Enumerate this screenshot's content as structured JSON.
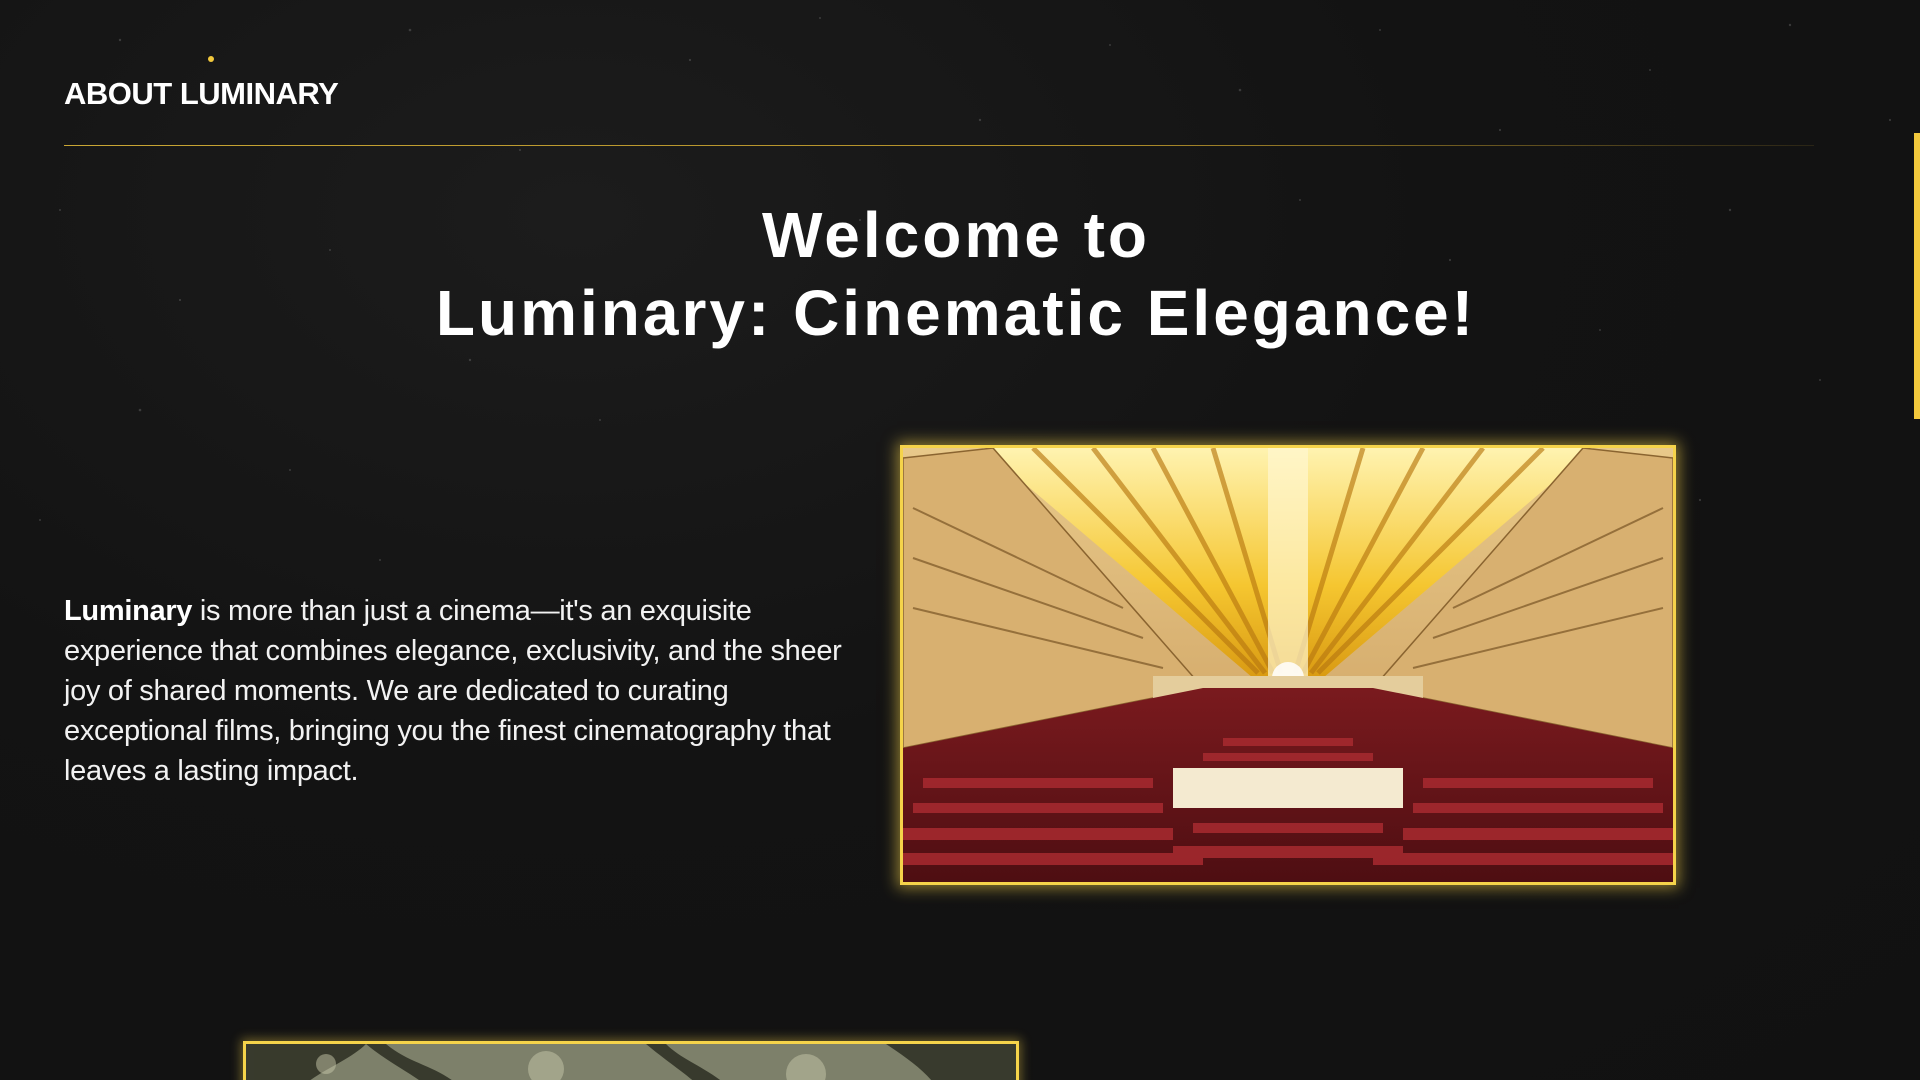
{
  "section": {
    "title": "ABOUT LUMINARY"
  },
  "headline": {
    "line1": "Welcome to",
    "line2": "Luminary: Cinematic Elegance!"
  },
  "intro": {
    "brand": "Luminary",
    "text": " is more than just a cinema—it's an exquisite experience that combines elegance, exclusivity, and the sheer joy of shared moments. We are dedicated to curating exceptional films, bringing you the finest cinematography that leaves a lasting impact."
  },
  "images": {
    "auditorium": "auditorium-photo",
    "second": "trees-photo"
  },
  "colors": {
    "background": "#121212",
    "accent": "#f5d34a",
    "text": "#ffffff"
  }
}
